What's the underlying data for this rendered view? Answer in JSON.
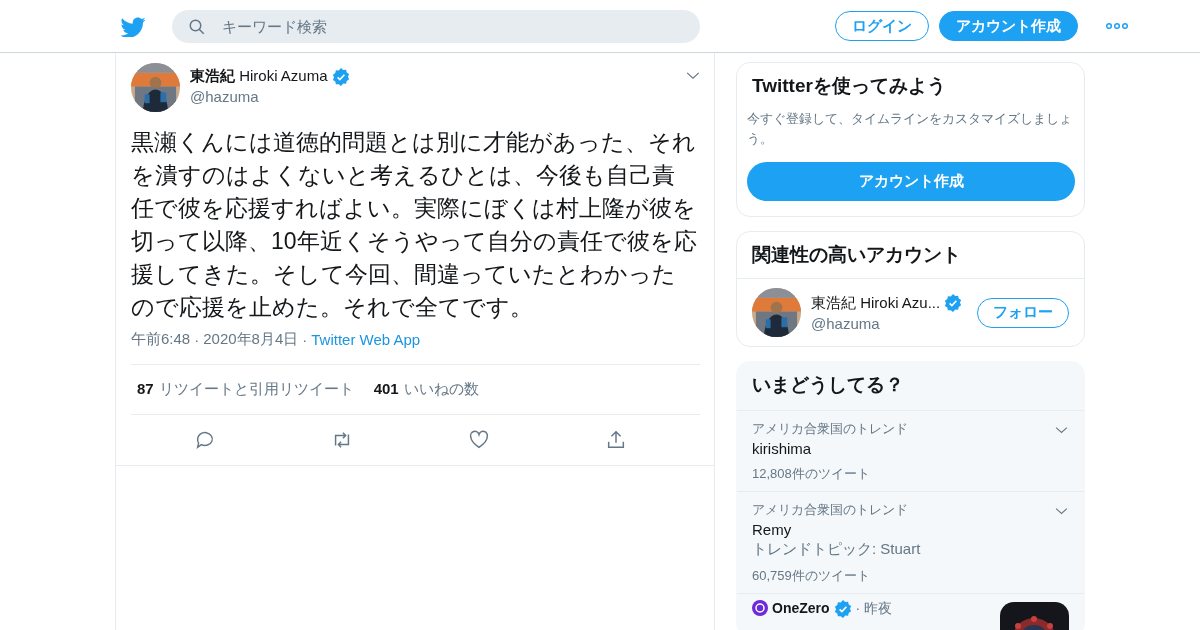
{
  "header": {
    "search": {
      "placeholder": "キーワード検索"
    },
    "buttons": [
      {
        "label": "ログイン",
        "kind": "outline"
      },
      {
        "label": "アカウント作成",
        "kind": "filled"
      }
    ]
  },
  "tweet": {
    "name": "東浩紀",
    "display": "Hiroki Azuma",
    "verified": true,
    "handle": "@hazuma",
    "text": "黒瀬くんには道徳的問題とは別に才能があった、それを潰すのはよくないと考えるひとは、今後も自己責任で彼を応援すればよい。実際にぼくは村上隆が彼を切って以降、10年近くそうやって自分の責任で彼を応援してきた。そして今回、間違っていたとわかったので応援を止めた。それで全てです。",
    "time": "午前6:48",
    "separator": "·",
    "date": "2020年8月4日",
    "source": "Twitter Web App",
    "stats": [
      {
        "count": "87",
        "label": "リツイートと引用リツイート"
      },
      {
        "count": "401",
        "label": "いいねの数"
      }
    ],
    "actions": [
      {
        "kind": "reply"
      },
      {
        "kind": "retweet"
      },
      {
        "kind": "like"
      },
      {
        "kind": "share"
      }
    ]
  },
  "signup": {
    "title": "Twitterを使ってみよう",
    "text": "今すぐ登録して、タイムラインをカスタマイズしましょう。",
    "button": "アカウント作成"
  },
  "related": {
    "title": "関連性の高いアカウント",
    "accounts": [
      {
        "name": "東浩紀 Hiroki Azu...",
        "verified": true,
        "handle": "@hazuma",
        "button": "フォロー"
      }
    ]
  },
  "trends": {
    "title": "いまどうしてる？",
    "items": [
      {
        "kind": "trend",
        "context": "アメリカ合衆国のトレンド",
        "name": "kirishima",
        "count": "12,808件のツイート"
      },
      {
        "kind": "trend",
        "context": "アメリカ合衆国のトレンド",
        "name": "Remy",
        "topic": "トレンドトピック: Stuart",
        "count": "60,759件のツイート"
      },
      {
        "kind": "news",
        "source": "OneZero",
        "verified": true,
        "separator": "·",
        "time": "昨夜"
      }
    ]
  }
}
